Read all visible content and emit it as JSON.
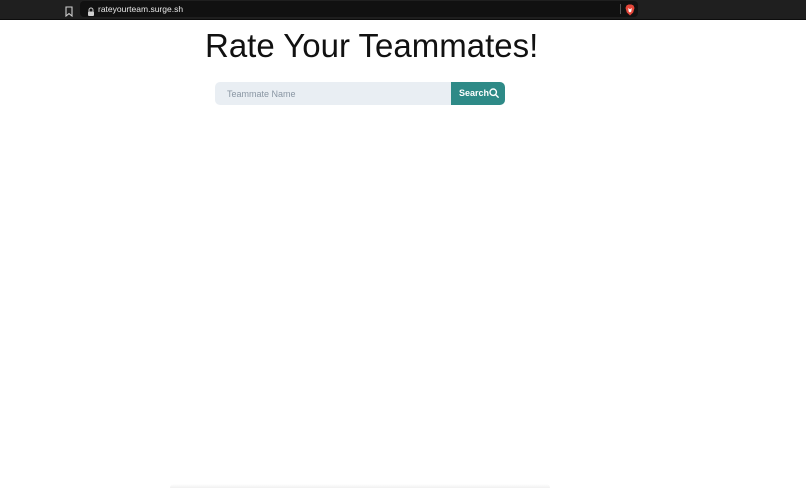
{
  "browser": {
    "url": "rateyourteam.surge.sh",
    "icons": {
      "bookmark": "bookmark-icon",
      "lock": "lock-icon",
      "shield": "brave-shield-icon"
    },
    "shield_color": "#e5473a"
  },
  "page": {
    "title": "Rate Your Teammates!"
  },
  "search": {
    "placeholder": "Teammate Name",
    "value": "",
    "button_label": "Search",
    "button_icon": "search-icon",
    "button_color": "#2e8a87",
    "input_background": "#e9eef3"
  }
}
